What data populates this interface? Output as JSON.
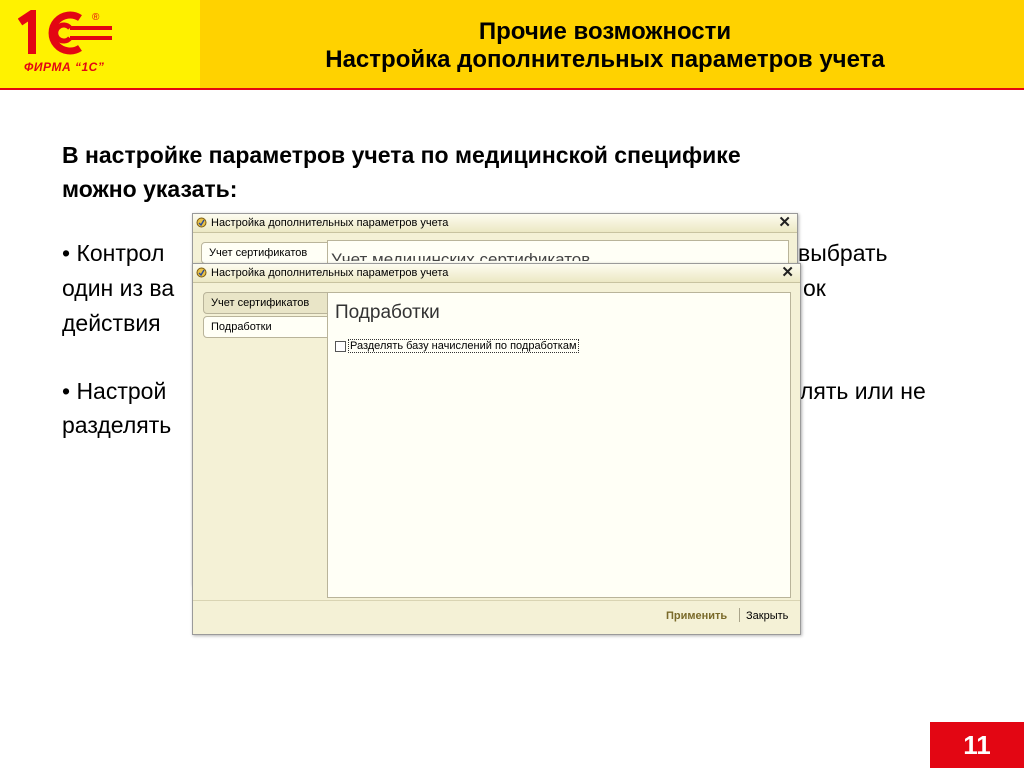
{
  "header": {
    "logo_text": "ФИРМА “1С”",
    "title_line1": "Прочие возможности",
    "title_line2": "Настройка дополнительных параметров учета"
  },
  "body": {
    "intro_line1": "В настройке параметров учета по медицинской специфике",
    "intro_line2": "можно указать:",
    "bullet1_a": "• Контрол",
    "bullet1_b": "выбрать",
    "bullet1_c": "один из ва",
    "bullet1_d": "ок",
    "bullet1_e": "действия",
    "bullet2_a": "• Настрой",
    "bullet2_b": "лять или не",
    "bullet2_c": "разделять"
  },
  "back_window": {
    "title": "Настройка дополнительных параметров учета",
    "tab1": "Учет сертификатов",
    "heading": "Учет медицинских сертификатов"
  },
  "front_window": {
    "title": "Настройка дополнительных параметров учета",
    "tabs": [
      "Учет сертификатов",
      "Подработки"
    ],
    "section_title": "Подработки",
    "checkbox_label": "Разделять базу начислений по подработкам",
    "checkbox_checked": false,
    "apply_label": "Применить",
    "close_label": "Закрыть"
  },
  "slide_number": "11",
  "colors": {
    "brand_red": "#e30613",
    "brand_yellow": "#ffd200"
  },
  "icons": [
    "1c-logo-icon",
    "window-app-icon",
    "close-icon"
  ]
}
